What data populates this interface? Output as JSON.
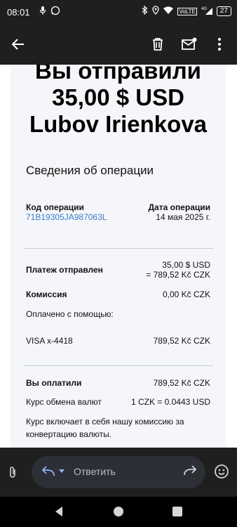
{
  "status": {
    "time": "08:01",
    "signal_label": "VoLTE",
    "net": "4G",
    "battery": "27"
  },
  "email": {
    "title_line1": "Вы отправили",
    "title_line2": "35,00 $ USD",
    "title_line3": "Lubov Irienkova",
    "section_title": "Сведения об операции",
    "op_code_label": "Код операции",
    "op_code_value": "71B19305JA987063L",
    "op_date_label": "Дата операции",
    "op_date_value": "14 мая 2025 г.",
    "payment_sent_label": "Платеж отправлен",
    "payment_sent_value1": "35,00 $ USD",
    "payment_sent_value2": "= 789,52 Kč CZK",
    "fee_label": "Комиссия",
    "fee_value": "0,00 Kč CZK",
    "paid_with_label": "Оплачено с помощью:",
    "card_label": "VISA x-4418",
    "card_value": "789,52 Kč CZK",
    "you_paid_label": "Вы оплатили",
    "you_paid_value": "789,52 Kč CZK",
    "rate_label": "Курс обмена валют",
    "rate_value": "1 CZK = 0.0443 USD",
    "rate_note_line1": "Курс включает в себя нашу комиссию за",
    "rate_note_line2": "конвертацию валюты."
  },
  "reply": {
    "placeholder": "Ответить"
  },
  "icons": {
    "back": "arrow-left",
    "delete": "trash",
    "mark_unread": "mail-badge",
    "more": "more-vert",
    "attach": "paperclip",
    "reply_action": "reply-arrow",
    "forward": "forward-arrow",
    "emoji": "smiley"
  }
}
